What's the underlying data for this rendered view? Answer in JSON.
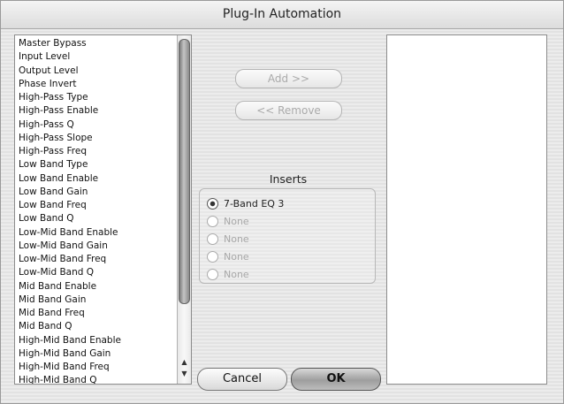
{
  "window": {
    "title": "Plug-In Automation"
  },
  "parameters": [
    "Master Bypass",
    "Input Level",
    "Output Level",
    "Phase Invert",
    "High-Pass Type",
    "High-Pass Enable",
    "High-Pass Q",
    "High-Pass Slope",
    "High-Pass Freq",
    "Low Band Type",
    "Low Band Enable",
    "Low Band Gain",
    "Low Band Freq",
    "Low Band Q",
    "Low-Mid Band Enable",
    "Low-Mid Band Gain",
    "Low-Mid Band Freq",
    "Low-Mid Band Q",
    "Mid Band Enable",
    "Mid Band Gain",
    "Mid Band Freq",
    "Mid Band Q",
    "High-Mid Band Enable",
    "High-Mid Band Gain",
    "High-Mid Band Freq",
    "High-Mid Band Q"
  ],
  "buttons": {
    "add": "Add >>",
    "remove": "<< Remove",
    "cancel": "Cancel",
    "ok": "OK"
  },
  "inserts": {
    "title": "Inserts",
    "items": [
      {
        "label": "7-Band EQ 3",
        "selected": true
      },
      {
        "label": "None",
        "selected": false
      },
      {
        "label": "None",
        "selected": false
      },
      {
        "label": "None",
        "selected": false
      },
      {
        "label": "None",
        "selected": false
      }
    ]
  },
  "automated_parameters": [],
  "icons": {
    "scroll_up": "scroll-up-arrow-icon",
    "scroll_down": "scroll-down-arrow-icon"
  }
}
